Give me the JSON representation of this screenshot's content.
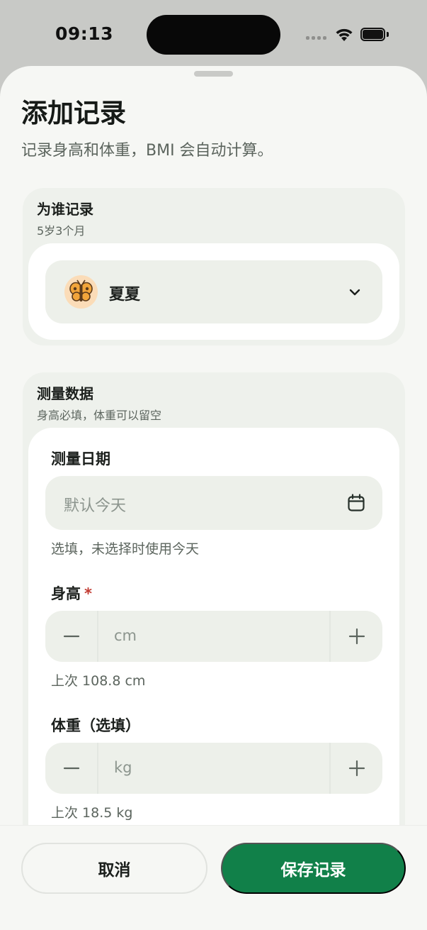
{
  "status_bar": {
    "time": "09:13"
  },
  "sheet": {
    "title": "添加记录",
    "subtitle": "记录身高和体重，BMI 会自动计算。"
  },
  "who_section": {
    "title": "为谁记录",
    "hint": "5岁3个月",
    "child": {
      "name": "夏夏",
      "avatar_icon": "butterfly-icon"
    }
  },
  "measure_section": {
    "title": "测量数据",
    "hint": "身高必填，体重可以留空",
    "date": {
      "label": "测量日期",
      "placeholder": "默认今天",
      "helper": "选填，未选择时使用今天"
    },
    "height": {
      "label": "身高",
      "required_mark": "*",
      "unit_placeholder": "cm",
      "last": "上次 108.8 cm"
    },
    "weight": {
      "label": "体重（选填）",
      "unit_placeholder": "kg",
      "last": "上次 18.5 kg"
    }
  },
  "footer": {
    "cancel_label": "取消",
    "save_label": "保存记录"
  },
  "colors": {
    "accent": "#118049",
    "required": "#c23a31",
    "sheet_bg": "#f6f7f4",
    "field_bg": "#edf0ea"
  }
}
